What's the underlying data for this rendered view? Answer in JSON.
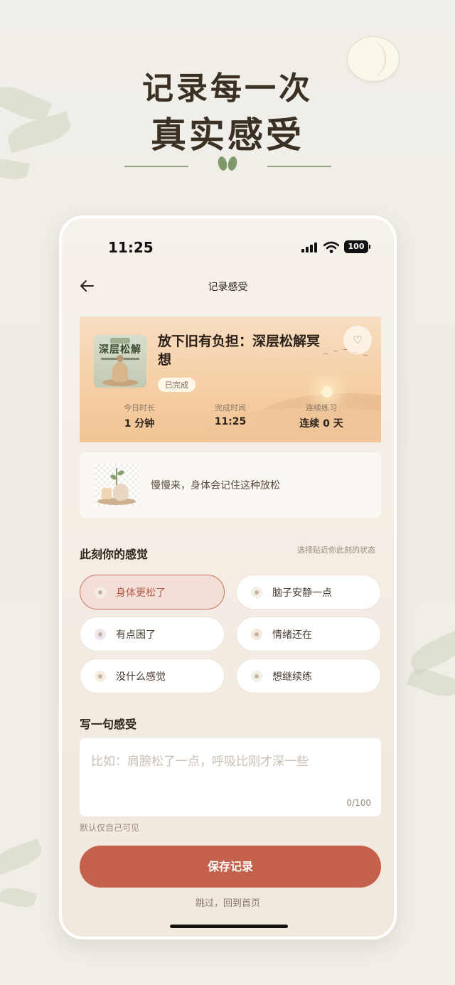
{
  "hero": {
    "line1": "记录每一次",
    "line2": "真实感受"
  },
  "status_bar": {
    "time": "11:25",
    "battery": "100"
  },
  "nav": {
    "title": "记录感受"
  },
  "session": {
    "thumb_title": "深层松解",
    "title": "放下旧有负担：深层松解冥想",
    "badge": "已完成",
    "stats": [
      {
        "label": "今日时长",
        "value": "1 分钟"
      },
      {
        "label": "完成时间",
        "value": "11:25"
      },
      {
        "label": "连续练习",
        "value": "连续 0 天"
      }
    ]
  },
  "quote": {
    "text": "慢慢来，身体会记住这种放松"
  },
  "feelings": {
    "title": "此刻你的感觉",
    "hint": "选择贴近你此刻的状态",
    "options": [
      {
        "label": "身体更松了",
        "icon": "leaf-icon",
        "selected": true
      },
      {
        "label": "脑子安静一点",
        "icon": "calm-icon",
        "selected": false
      },
      {
        "label": "有点困了",
        "icon": "moon-icon",
        "selected": false
      },
      {
        "label": "情绪还在",
        "icon": "cloud-icon",
        "selected": false
      },
      {
        "label": "没什么感觉",
        "icon": "neutral-face-icon",
        "selected": false
      },
      {
        "label": "想继续练",
        "icon": "sprout-icon",
        "selected": false
      }
    ]
  },
  "note": {
    "title": "写一句感受",
    "placeholder": "比如：肩膀松了一点，呼吸比刚才深一些",
    "counter": "0/100",
    "privacy": "默认仅自己可见"
  },
  "actions": {
    "save": "保存记录",
    "skip": "跳过，回到首页"
  },
  "colors": {
    "accent": "#c4614a",
    "selected_bg": "#f3dfd8",
    "green": "#8fa27a"
  }
}
